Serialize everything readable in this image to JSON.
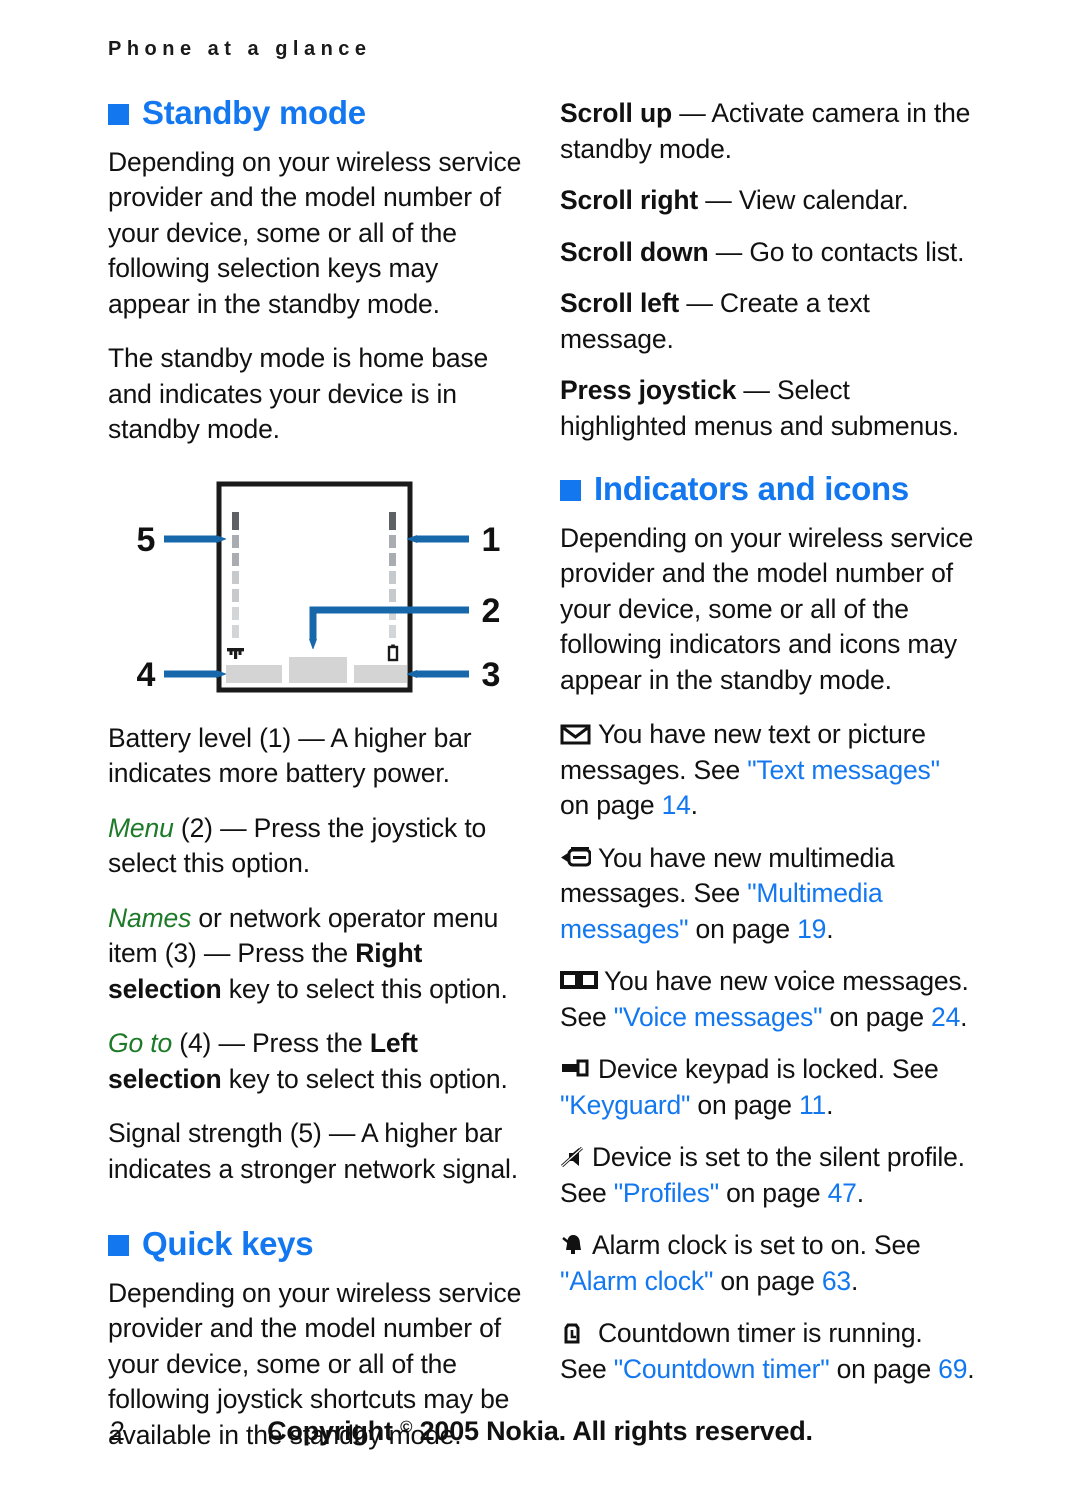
{
  "header": {
    "running_head": "Phone at a glance"
  },
  "left_column": {
    "standby": {
      "heading": "Standby mode",
      "bullet_icon": "blue-square-bullet",
      "paragraphs": [
        "Depending on your wireless service provider and the model number of your device, some or all of the following selection keys may appear in the standby mode.",
        "The standby mode is home base and indicates your device is in standby mode."
      ]
    },
    "diagram": {
      "name": "phone-standby-screen-diagram",
      "callouts": [
        "1",
        "2",
        "3",
        "4",
        "5"
      ],
      "signal_glyph": "antenna-icon",
      "battery_glyph": "battery-icon",
      "softkeys": [
        "left-softkey-bar",
        "center-softkey-bar",
        "right-softkey-bar"
      ]
    },
    "legend": [
      {
        "lead": "Battery level",
        "lead_style": "plain",
        "number": "(1)",
        "dash": "—",
        "rest": "A higher bar indicates more battery power.",
        "bold_part": ""
      },
      {
        "lead": "Menu",
        "lead_style": "green-italic",
        "number": "(2)",
        "dash": "—",
        "rest": "Press the joystick to select this option.",
        "bold_part": ""
      },
      {
        "lead": "Names",
        "lead_style": "green-italic",
        "number": "(3)",
        "dash": "—",
        "middle": " or network operator menu item ",
        "rest_before_bold": "Press the ",
        "bold_part": "Right selection",
        "rest_after_bold": " key to select this option."
      },
      {
        "lead": "Go to",
        "lead_style": "green-italic",
        "number": "(4)",
        "dash": "—",
        "rest_before_bold": "Press the ",
        "bold_part": "Left selection",
        "rest_after_bold": " key to select this option."
      },
      {
        "lead": "Signal strength",
        "lead_style": "plain",
        "number": "(5)",
        "dash": "—",
        "rest": "A higher bar indicates a stronger network signal.",
        "bold_part": ""
      }
    ],
    "quick_keys": {
      "heading": "Quick keys",
      "bullet_icon": "blue-square-bullet",
      "paragraph": "Depending on your wireless service provider and the model number of your device, some or all of the following joystick shortcuts may be available in the standby mode."
    }
  },
  "right_column": {
    "quick_key_items": [
      {
        "label": "Scroll up",
        "dash": "—",
        "text": "Activate camera in the standby mode."
      },
      {
        "label": "Scroll right",
        "dash": "—",
        "text": "View calendar."
      },
      {
        "label": "Scroll down",
        "dash": "—",
        "text": "Go to contacts list."
      },
      {
        "label": "Scroll left",
        "dash": "—",
        "text": "Create a text message."
      },
      {
        "label": "Press joystick",
        "dash": "—",
        "text": "Select highlighted menus and submenus."
      }
    ],
    "indicators": {
      "heading": "Indicators and icons",
      "bullet_icon": "blue-square-bullet",
      "paragraph": "Depending on your wireless service provider and the model number of your device, some or all of the following indicators and icons may appear in the standby mode.",
      "items": [
        {
          "icon": "envelope-icon",
          "text_before": "You have new text or picture messages. See ",
          "link": "\"Text messages\"",
          "text_mid": " on page ",
          "page": "14",
          "text_after": "."
        },
        {
          "icon": "multimedia-message-icon",
          "text_before": "You have new multimedia messages. See ",
          "link": "\"Multimedia messages\"",
          "text_mid": " on page ",
          "page": "19",
          "text_after": "."
        },
        {
          "icon": "voice-message-icon",
          "text_before": "You have new voice messages. See ",
          "link": "\"Voice messages\"",
          "text_mid": " on page ",
          "page": "24",
          "text_after": "."
        },
        {
          "icon": "keypad-lock-icon",
          "text_before": "Device keypad is locked. See ",
          "link": "\"Keyguard\"",
          "text_mid": " on page ",
          "page": "11",
          "text_after": "."
        },
        {
          "icon": "silent-profile-icon",
          "text_before": "Device is set to the silent profile. See ",
          "link": "\"Profiles\"",
          "text_mid": " on page ",
          "page": "47",
          "text_after": "."
        },
        {
          "icon": "alarm-clock-icon",
          "text_before": "Alarm clock is set to on. See ",
          "link": "\"Alarm clock\"",
          "text_mid": " on page ",
          "page": "63",
          "text_after": "."
        },
        {
          "icon": "countdown-timer-icon",
          "text_before": "Countdown timer is running. See ",
          "link": "\"Countdown timer\"",
          "text_mid": " on page ",
          "page": "69",
          "text_after": "."
        }
      ]
    }
  },
  "footer": {
    "page_number": "2",
    "copyright_before": "Copyright ",
    "copyright_symbol": "©",
    "copyright_after": " 2005 Nokia. All rights reserved."
  },
  "colors": {
    "heading_blue": "#1378f0",
    "link_blue": "#1378f0",
    "green_italic": "#1d7a28",
    "arrow_blue": "#1767ab",
    "softkey_gray": "#d4d4d4",
    "text_black": "#111111"
  }
}
